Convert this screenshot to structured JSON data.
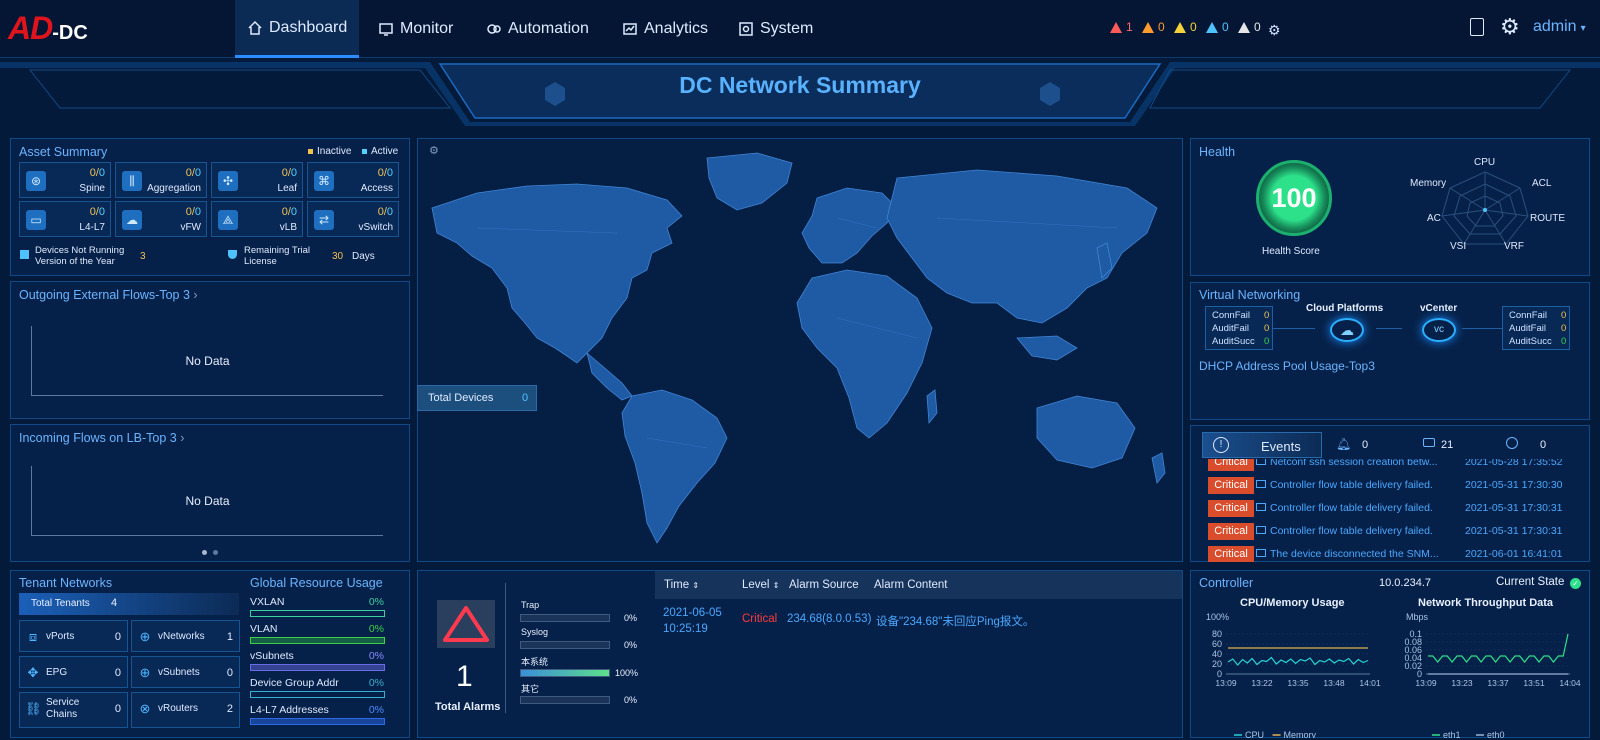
{
  "nav": {
    "logo_ad": "AD",
    "logo_dc": "-DC",
    "tabs": [
      {
        "label": "Dashboard"
      },
      {
        "label": "Monitor"
      },
      {
        "label": "Automation"
      },
      {
        "label": "Analytics"
      },
      {
        "label": "System"
      }
    ],
    "alarms": [
      {
        "count": "1",
        "color": "#ff5a5a"
      },
      {
        "count": "0",
        "color": "#ff9a2e"
      },
      {
        "count": "0",
        "color": "#f5d23a"
      },
      {
        "count": "0",
        "color": "#4fc3ff"
      },
      {
        "count": "0",
        "color": "#e6e6e6"
      }
    ],
    "user": "admin"
  },
  "banner": {
    "title": "DC Network Summary"
  },
  "asset_summary": {
    "title": "Asset Summary",
    "legend_inactive": "Inactive",
    "legend_active": "Active",
    "items": [
      {
        "name": "Spine",
        "inactive": "0",
        "active": "0"
      },
      {
        "name": "Aggregation",
        "inactive": "0",
        "active": "0"
      },
      {
        "name": "Leaf",
        "inactive": "0",
        "active": "0"
      },
      {
        "name": "Access",
        "inactive": "0",
        "active": "0"
      },
      {
        "name": "L4-L7",
        "inactive": "0",
        "active": "0"
      },
      {
        "name": "vFW",
        "inactive": "0",
        "active": "0"
      },
      {
        "name": "vLB",
        "inactive": "0",
        "active": "0"
      },
      {
        "name": "vSwitch",
        "inactive": "0",
        "active": "0"
      }
    ],
    "not_running_label": "Devices Not Running Version of the Year",
    "not_running_value": "3",
    "trial_label": "Remaining Trial License",
    "trial_value": "30",
    "trial_unit": "Days"
  },
  "outgoing_flows": {
    "title": "Outgoing External Flows-Top 3",
    "empty": "No Data"
  },
  "incoming_flows": {
    "title": "Incoming Flows on LB-Top 3",
    "empty": "No Data"
  },
  "map": {
    "total_devices_label": "Total Devices",
    "total_devices_value": "0"
  },
  "health": {
    "title": "Health",
    "score": "100",
    "score_label": "Health Score",
    "radar_axes": [
      "CPU",
      "ACL",
      "ROUTE",
      "VRF",
      "VSI",
      "AC",
      "Memory"
    ]
  },
  "virtual_networking": {
    "title": "Virtual Networking",
    "cloud_label": "Cloud Platforms",
    "vcenter_label": "vCenter",
    "left_stats": [
      {
        "label": "ConnFail",
        "value": "0"
      },
      {
        "label": "AuditFail",
        "value": "0"
      },
      {
        "label": "AuditSucc",
        "value": "0"
      }
    ],
    "right_stats": [
      {
        "label": "ConnFail",
        "value": "0"
      },
      {
        "label": "AuditFail",
        "value": "0"
      },
      {
        "label": "AuditSucc",
        "value": "0"
      }
    ],
    "dhcp_title": "DHCP Address Pool Usage-Top3"
  },
  "events": {
    "title": "Events",
    "bell_count": "0",
    "chat_count": "21",
    "other_count": "0",
    "rows": [
      {
        "level": "Critical",
        "message": "Netconf ssh session creation betw...",
        "time": "2021-05-28 17:35:52"
      },
      {
        "level": "Critical",
        "message": "Controller flow table delivery failed.",
        "time": "2021-05-31 17:30:30"
      },
      {
        "level": "Critical",
        "message": "Controller flow table delivery failed.",
        "time": "2021-05-31 17:30:31"
      },
      {
        "level": "Critical",
        "message": "Controller flow table delivery failed.",
        "time": "2021-05-31 17:30:31"
      },
      {
        "level": "Critical",
        "message": "The device disconnected the SNM...",
        "time": "2021-06-01 16:41:01"
      }
    ]
  },
  "tenant_networks": {
    "title": "Tenant Networks",
    "total_label": "Total Tenants",
    "total_value": "4",
    "items": [
      {
        "label": "vPorts",
        "value": "0"
      },
      {
        "label": "vNetworks",
        "value": "1"
      },
      {
        "label": "EPG",
        "value": "0"
      },
      {
        "label": "vSubnets",
        "value": "0"
      },
      {
        "label": "Service Chains",
        "value": "0"
      },
      {
        "label": "vRouters",
        "value": "2"
      }
    ]
  },
  "global_resource": {
    "title": "Global Resource Usage",
    "rows": [
      {
        "label": "VXLAN",
        "percent": "0%",
        "color": "#3ad0a0"
      },
      {
        "label": "VLAN",
        "percent": "0%",
        "color": "#3ad04a"
      },
      {
        "label": "vSubnets",
        "percent": "0%",
        "color": "#6a6ae8"
      },
      {
        "label": "Device Group Addr",
        "percent": "0%",
        "color": "#3ab0d0"
      },
      {
        "label": "L4-L7 Addresses",
        "percent": "0%",
        "color": "#2a6ae8"
      }
    ]
  },
  "alarms_panel": {
    "total_value": "1",
    "total_label": "Total Alarms",
    "sources": [
      {
        "label": "Trap",
        "percent": "0%",
        "fill": 0
      },
      {
        "label": "Syslog",
        "percent": "0%",
        "fill": 0
      },
      {
        "label": "本系统",
        "percent": "100%",
        "fill": 1
      },
      {
        "label": "其它",
        "percent": "0%",
        "fill": 0
      }
    ],
    "table_headers": [
      "Time",
      "Level",
      "Alarm Source",
      "Alarm Content"
    ],
    "rows": [
      {
        "time_date": "2021-06-05",
        "time_clock": "10:25:19",
        "level": "Critical",
        "source": "234.68(8.0.0.53)",
        "content": "设备\"234.68\"未回应Ping报文。"
      }
    ]
  },
  "controller": {
    "title": "Controller",
    "ip": "10.0.234.7",
    "state_label": "Current State",
    "cpu_chart_title": "CPU/Memory Usage",
    "net_chart_title": "Network Throughput Data"
  },
  "chart_data": [
    {
      "type": "line",
      "title": "CPU/Memory Usage",
      "ylabel": "100%",
      "ylim": [
        0,
        80
      ],
      "y_ticks": [
        "80",
        "60",
        "40",
        "20",
        "0"
      ],
      "x_ticks": [
        "13:09",
        "13:22",
        "13:35",
        "13:48",
        "14:01"
      ],
      "series": [
        {
          "name": "CPU",
          "color": "#27d3d6",
          "values": [
            24,
            30,
            18,
            29,
            22,
            31,
            19,
            27,
            25,
            33,
            20,
            28,
            23,
            30,
            21,
            29,
            26,
            32,
            19,
            27,
            24,
            30,
            22,
            28,
            25,
            31,
            20,
            29,
            23,
            27
          ]
        },
        {
          "name": "Memory",
          "color": "#e0b050",
          "values": [
            52,
            52,
            52,
            52,
            52,
            52,
            52,
            52,
            52,
            52,
            52,
            52,
            52,
            52,
            52,
            52,
            52,
            52,
            52,
            52,
            52,
            52,
            52,
            52,
            52,
            52,
            52,
            52,
            52,
            52
          ]
        }
      ]
    },
    {
      "type": "line",
      "title": "Network Throughput Data",
      "ylabel": "Mbps",
      "ylim": [
        0,
        0.1
      ],
      "y_ticks": [
        "0.1",
        "0.08",
        "0.06",
        "0.04",
        "0.02",
        "0"
      ],
      "x_ticks": [
        "13:09",
        "13:23",
        "13:37",
        "13:51",
        "14:04"
      ],
      "series": [
        {
          "name": "eth1",
          "color": "#2fe08a",
          "values": [
            0.045,
            0.045,
            0.03,
            0.045,
            0.045,
            0.03,
            0.045,
            0.045,
            0.03,
            0.045,
            0.045,
            0.03,
            0.045,
            0.045,
            0.03,
            0.045,
            0.045,
            0.03,
            0.045,
            0.045,
            0.03,
            0.045,
            0.045,
            0.03,
            0.045,
            0.045,
            0.03,
            0.045,
            0.045,
            0.1
          ]
        },
        {
          "name": "eth0",
          "color": "#9ab4d6",
          "values": [
            0,
            0,
            0,
            0,
            0,
            0,
            0,
            0,
            0,
            0,
            0,
            0,
            0,
            0,
            0,
            0,
            0,
            0,
            0,
            0,
            0,
            0,
            0,
            0,
            0,
            0,
            0,
            0,
            0,
            0
          ]
        }
      ]
    }
  ]
}
